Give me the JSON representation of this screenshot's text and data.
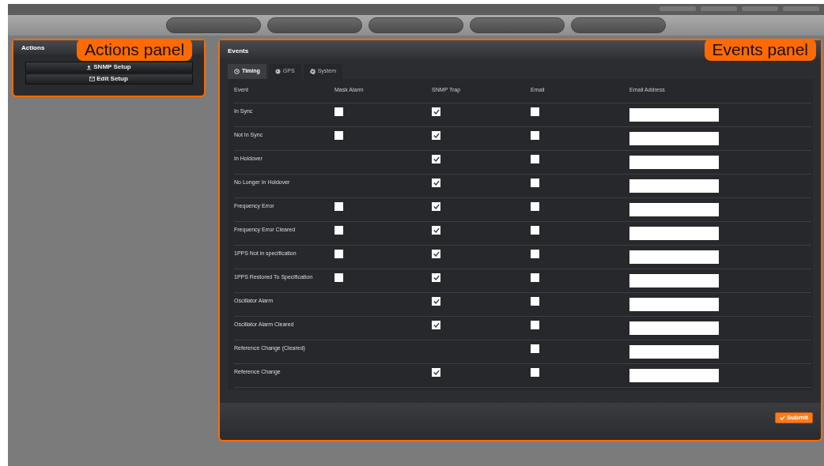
{
  "actions_panel": {
    "title": "Actions",
    "callout": "Actions panel",
    "buttons": [
      {
        "label": "SNMP Setup"
      },
      {
        "label": "Edit Setup"
      }
    ]
  },
  "events_panel": {
    "title": "Events",
    "callout": "Events panel",
    "tabs": [
      {
        "label": "Timing",
        "selected": true
      },
      {
        "label": "GPS",
        "selected": false
      },
      {
        "label": "System",
        "selected": false
      }
    ],
    "columns": [
      "Event",
      "Mask Alarm",
      "SNMP Trap",
      "Email",
      "Email Address"
    ],
    "rows": [
      {
        "event": "In Sync",
        "mask_alarm": false,
        "snmp_trap": true,
        "email": false
      },
      {
        "event": "Not In Sync",
        "mask_alarm": false,
        "snmp_trap": true,
        "email": false
      },
      {
        "event": "In Holdover",
        "snmp_trap": true,
        "email": false
      },
      {
        "event": "No Longer In Holdover",
        "snmp_trap": true,
        "email": false
      },
      {
        "event": "Frequency Error",
        "mask_alarm": false,
        "snmp_trap": true,
        "email": false
      },
      {
        "event": "Frequency Error Cleared",
        "mask_alarm": false,
        "snmp_trap": true,
        "email": false
      },
      {
        "event": "1PPS Not in specification",
        "mask_alarm": false,
        "snmp_trap": true,
        "email": false
      },
      {
        "event": "1PPS Restored To Specification",
        "mask_alarm": false,
        "snmp_trap": true,
        "email": false
      },
      {
        "event": "Oscillator Alarm",
        "snmp_trap": true,
        "email": false
      },
      {
        "event": "Oscillator Alarm Cleared",
        "snmp_trap": true,
        "email": false
      },
      {
        "event": "Reference Change (Cleared)",
        "email": false
      },
      {
        "event": "Reference Change",
        "snmp_trap": true,
        "email": false
      }
    ],
    "submit": "Submit"
  }
}
